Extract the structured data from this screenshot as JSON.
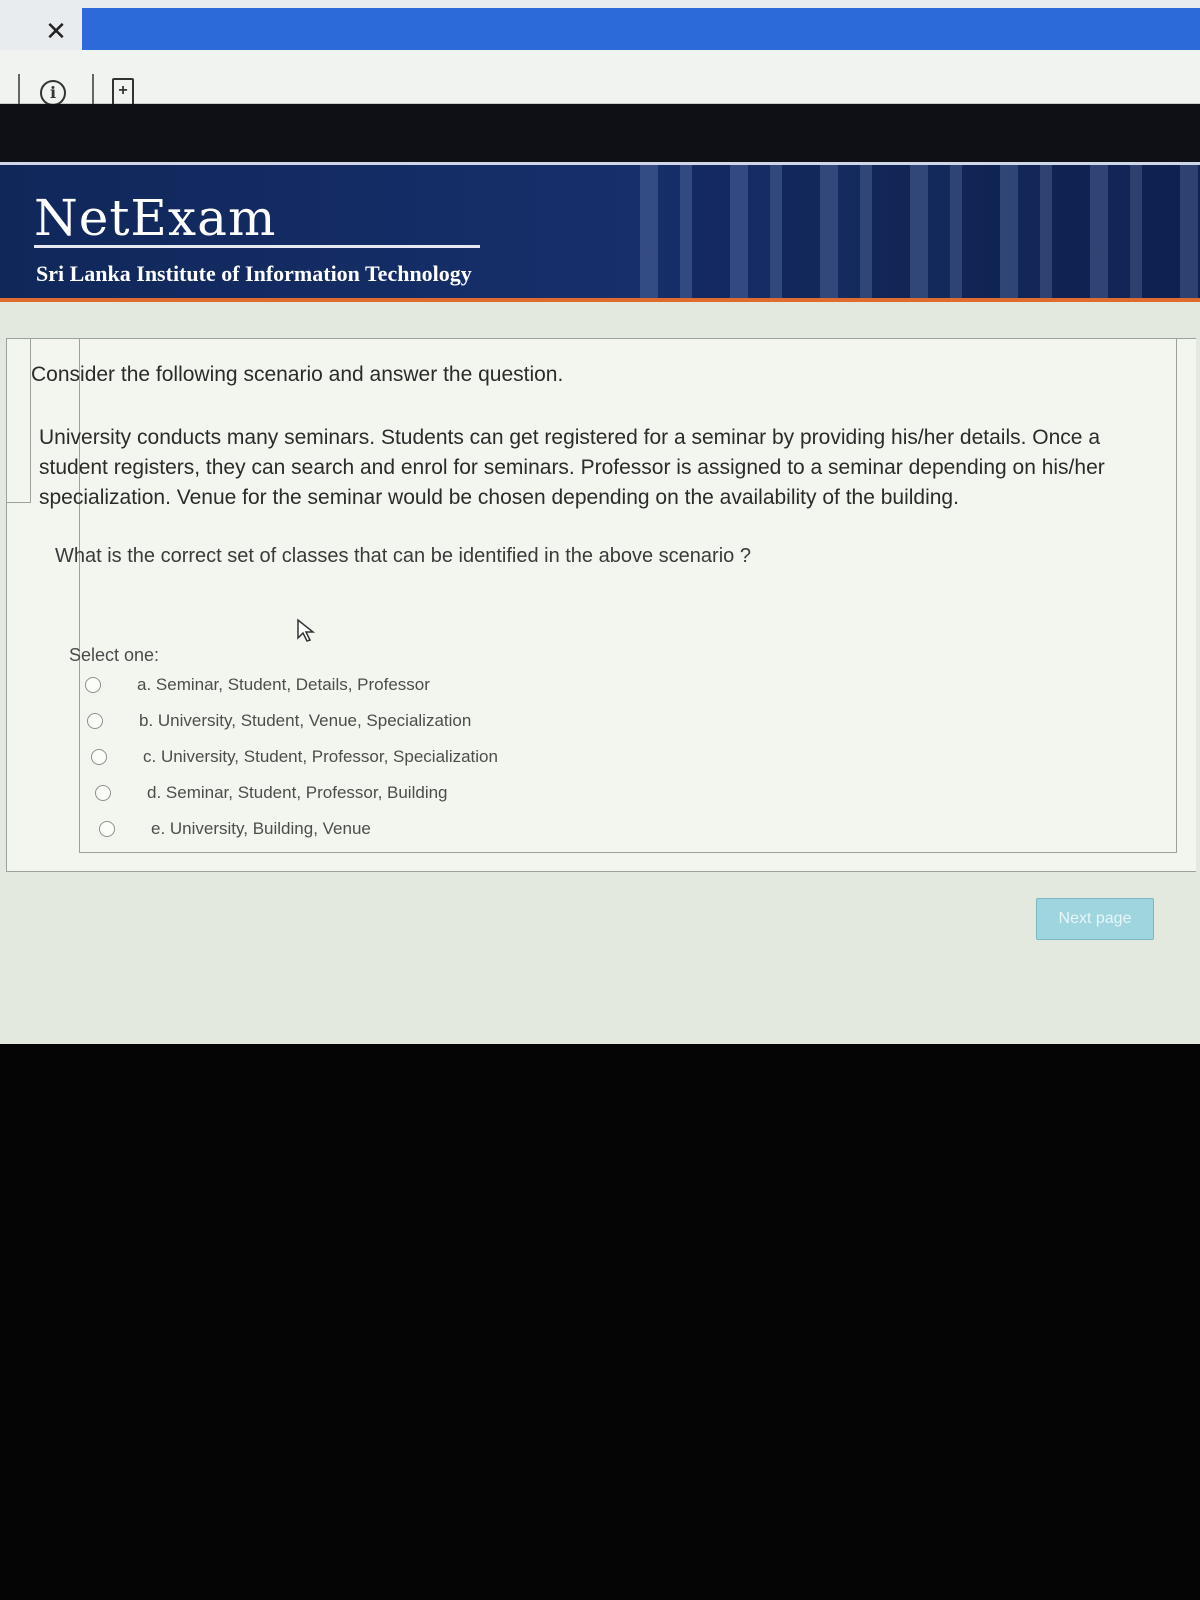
{
  "browser": {
    "close_glyph": "✕",
    "info_glyph": "i",
    "page_glyph": "+"
  },
  "header": {
    "brand": "NetExam",
    "subtitle": "Sri Lanka Institute of Information Technology",
    "accent_color": "#e06b2e",
    "banner_color": "#17306c"
  },
  "quiz": {
    "intro": "Consider the following scenario and answer the question.",
    "scenario": "University conducts many seminars. Students can get registered for a seminar by providing his/her details. Once a student registers, they can search and enrol for seminars. Professor is assigned to a seminar depending on his/her specialization. Venue for the seminar would be chosen depending on the availability of the building.",
    "question": "What is the correct set of classes that can be identified in the above scenario ?",
    "select_label": "Select one:",
    "options": [
      {
        "label": "a. Seminar, Student, Details, Professor"
      },
      {
        "label": "b. University, Student, Venue, Specialization"
      },
      {
        "label": "c. University, Student, Professor, Specialization"
      },
      {
        "label": "d. Seminar, Student, Professor, Building"
      },
      {
        "label": "e. University, Building, Venue"
      }
    ],
    "next_button": "Next page"
  }
}
